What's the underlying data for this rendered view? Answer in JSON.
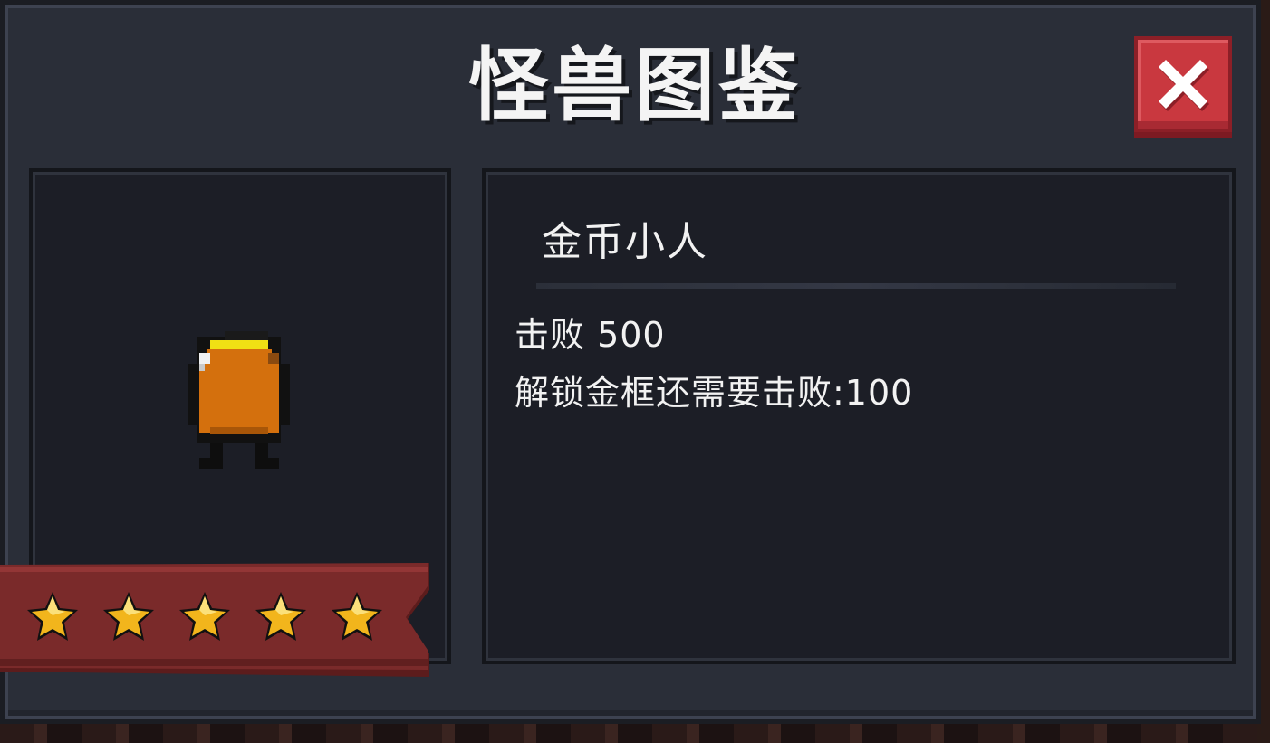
{
  "dialog": {
    "title": "怪兽图鉴"
  },
  "monster": {
    "name": "金币小人",
    "kills_text": "击败 500",
    "unlock_text": "解锁金框还需要击败:100",
    "star_rating": 5,
    "star_max": 5
  },
  "icons": {
    "close": "close-icon",
    "star": "star-icon",
    "monster": "gold-coin-creature-sprite"
  },
  "colors": {
    "panel_bg": "#2a2e38",
    "inner_bg": "#1c1e26",
    "close_button": "#c9383f",
    "ribbon": "#7a2a2a",
    "star": "#f2b51c",
    "monster_body": "#d4700d",
    "monster_rim": "#f0e014"
  }
}
